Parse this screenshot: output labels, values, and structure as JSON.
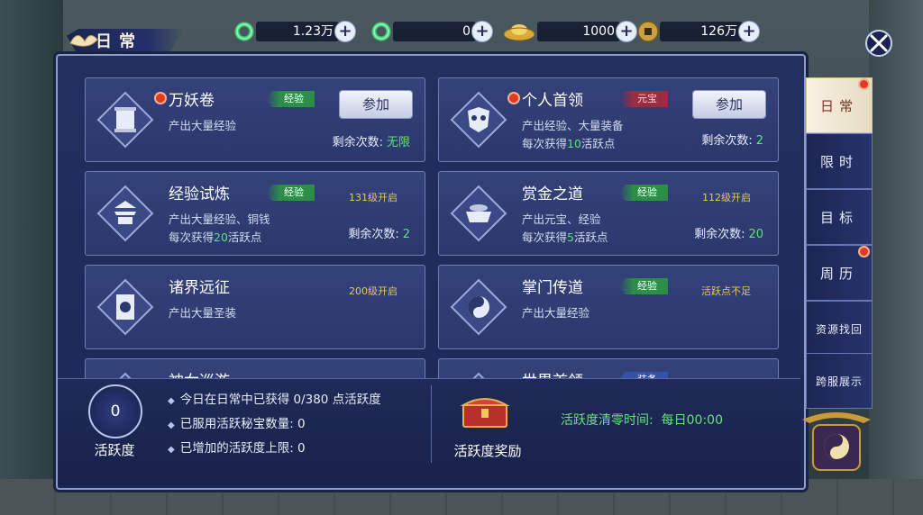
{
  "window": {
    "title": "日常"
  },
  "resources": [
    {
      "icon": "jade-ring-icon",
      "value": "1.23万"
    },
    {
      "icon": "jade-ring-icon",
      "value": "0"
    },
    {
      "icon": "gold-ingot-icon",
      "value": "1000"
    },
    {
      "icon": "coin-icon",
      "value": "126万"
    }
  ],
  "plus_label": "+",
  "activities": [
    {
      "name": "万妖卷",
      "tag": "经验",
      "tag_type": "exp",
      "desc": "产出大量经验",
      "desc2": "",
      "remain_label": "剩余次数:",
      "remain_value": "无限",
      "join": "参加",
      "red_dot": true,
      "icon": "scroll-icon"
    },
    {
      "name": "个人首领",
      "tag": "元宝",
      "tag_type": "yb",
      "desc": "产出经验、大量装备",
      "desc2_pre": "每次获得",
      "desc2_num": "10",
      "desc2_post": "活跃点",
      "remain_label": "剩余次数:",
      "remain_value": "2",
      "join": "参加",
      "red_dot": true,
      "icon": "demon-mask-icon"
    },
    {
      "name": "经验试炼",
      "tag": "经验",
      "tag_type": "exp",
      "desc": "产出大量经验、铜钱",
      "desc2_pre": "每次获得",
      "desc2_num": "20",
      "desc2_post": "活跃点",
      "remain_label": "剩余次数:",
      "remain_value": "2",
      "level": "131级开启",
      "icon": "pagoda-icon"
    },
    {
      "name": "赏金之道",
      "tag": "经验",
      "tag_type": "exp",
      "desc": "产出元宝、经验",
      "desc2_pre": "每次获得",
      "desc2_num": "5",
      "desc2_post": "活跃点",
      "remain_label": "剩余次数:",
      "remain_value": "20",
      "level": "112级开启",
      "icon": "treasure-bowl-icon"
    },
    {
      "name": "诸界远征",
      "tag": "",
      "desc": "产出大量圣装",
      "level": "200级开启",
      "icon": "war-banner-icon"
    },
    {
      "name": "掌门传道",
      "tag": "经验",
      "tag_type": "exp",
      "desc": "产出大量经验",
      "level": "活跃点不足",
      "icon": "taiji-icon"
    },
    {
      "name": "神女巡游",
      "icon": "scroll-icon"
    },
    {
      "name": "世界首领",
      "tag": "装备",
      "tag_type": "blue",
      "icon": "demon-mask-icon"
    }
  ],
  "activity_points": {
    "value": "0",
    "label": "活跃度"
  },
  "info_lines": [
    "今日在日常中已获得 0/380 点活跃度",
    "已服用活跃秘宝数量:  0",
    "已增加的活跃度上限: 0"
  ],
  "reward": {
    "label": "活跃度奖励",
    "icon": "treasure-chest-icon"
  },
  "reset": {
    "label": "活跃度清零时间:",
    "value": "每日00:00"
  },
  "tabs": [
    {
      "label": "日常",
      "active": true,
      "red_dot": true
    },
    {
      "label": "限时"
    },
    {
      "label": "目标"
    },
    {
      "label": "周历",
      "red_dot": true
    },
    {
      "label": "资源找回",
      "small": true
    },
    {
      "label": "跨服展示",
      "small": true
    }
  ],
  "colors": {
    "panel": "#23305e",
    "accent_green": "#5fe075",
    "tag_exp": "#2b8f4a",
    "tag_yb": "#9a2c44",
    "red_dot": "#e03a22"
  }
}
